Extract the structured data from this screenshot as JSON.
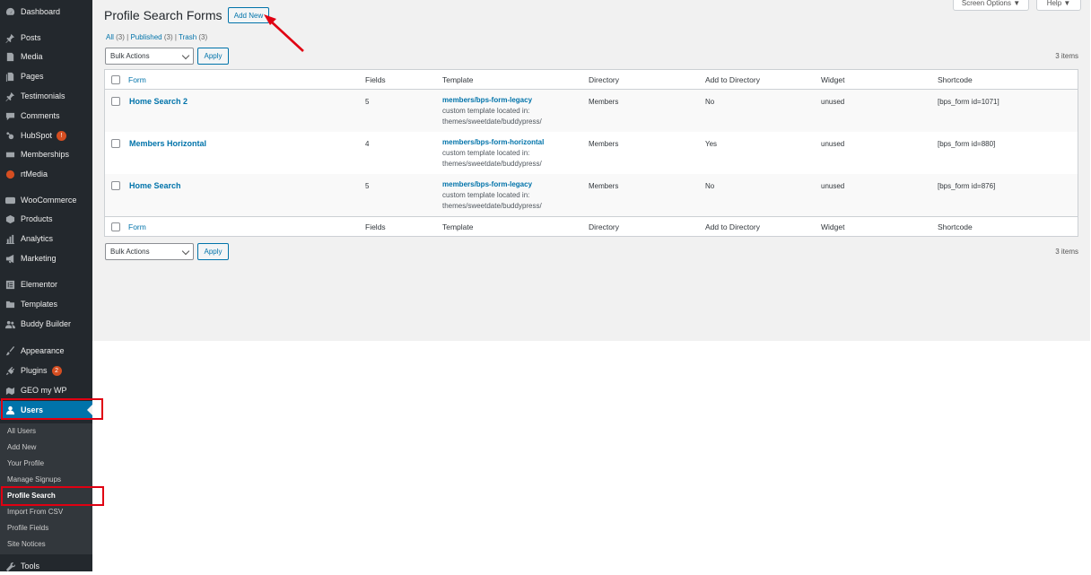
{
  "sidebar": {
    "items": [
      {
        "label": "Dashboard",
        "icon": "dashboard-icon"
      },
      {
        "label": "Posts",
        "icon": "pin-icon"
      },
      {
        "label": "Media",
        "icon": "media-icon"
      },
      {
        "label": "Pages",
        "icon": "page-icon"
      },
      {
        "label": "Testimonials",
        "icon": "pin-icon"
      },
      {
        "label": "Comments",
        "icon": "comment-icon"
      },
      {
        "label": "HubSpot",
        "icon": "hubspot-icon",
        "badge": "!"
      },
      {
        "label": "Memberships",
        "icon": "memberships-icon"
      },
      {
        "label": "rtMedia",
        "icon": "rtmedia-icon"
      },
      {
        "label": "WooCommerce",
        "icon": "woo-icon"
      },
      {
        "label": "Products",
        "icon": "products-icon"
      },
      {
        "label": "Analytics",
        "icon": "analytics-icon"
      },
      {
        "label": "Marketing",
        "icon": "megaphone-icon"
      },
      {
        "label": "Elementor",
        "icon": "elementor-icon"
      },
      {
        "label": "Templates",
        "icon": "folder-icon"
      },
      {
        "label": "Buddy Builder",
        "icon": "buddy-icon"
      },
      {
        "label": "Appearance",
        "icon": "brush-icon"
      },
      {
        "label": "Plugins",
        "icon": "plug-icon",
        "badge": "2"
      },
      {
        "label": "GEO my WP",
        "icon": "geo-icon"
      },
      {
        "label": "Users",
        "icon": "user-icon"
      },
      {
        "label": "Tools",
        "icon": "wrench-icon"
      }
    ],
    "users_submenu": [
      "All Users",
      "Add New",
      "Your Profile",
      "Manage Signups",
      "Profile Search",
      "Import From CSV",
      "Profile Fields",
      "Site Notices"
    ]
  },
  "header": {
    "title": "Profile Search Forms",
    "add_new": "Add New",
    "screen_options": "Screen Options ▼",
    "help": "Help ▼"
  },
  "filters": {
    "all": "All",
    "all_count": "(3)",
    "published": "Published",
    "published_count": "(3)",
    "trash": "Trash",
    "trash_count": "(3)",
    "sep": "|"
  },
  "bulk": {
    "label": "Bulk Actions",
    "apply": "Apply",
    "items": "3 items"
  },
  "table": {
    "columns": [
      "Form",
      "Fields",
      "Template",
      "Directory",
      "Add to Directory",
      "Widget",
      "Shortcode"
    ],
    "rows": [
      {
        "form": "Home Search 2",
        "fields": "5",
        "template": "members/bps-form-legacy",
        "tpl_line2": "custom template located in:",
        "tpl_line3": "themes/sweetdate/buddypress/",
        "directory": "Members",
        "add": "No",
        "widget": "unused",
        "shortcode": "[bps_form id=1071]"
      },
      {
        "form": "Members Horizontal",
        "fields": "4",
        "template": "members/bps-form-horizontal",
        "tpl_line2": "custom template located in:",
        "tpl_line3": "themes/sweetdate/buddypress/",
        "directory": "Members",
        "add": "Yes",
        "widget": "unused",
        "shortcode": "[bps_form id=880]"
      },
      {
        "form": "Home Search",
        "fields": "5",
        "template": "members/bps-form-legacy",
        "tpl_line2": "custom template located in:",
        "tpl_line3": "themes/sweetdate/buddypress/",
        "directory": "Members",
        "add": "No",
        "widget": "unused",
        "shortcode": "[bps_form id=876]"
      }
    ]
  },
  "colors": {
    "sidebar": "#23282d",
    "submenu": "#32373c",
    "accent": "#0073aa",
    "highlight": "#e00012",
    "content_bg": "#f1f1f1"
  }
}
